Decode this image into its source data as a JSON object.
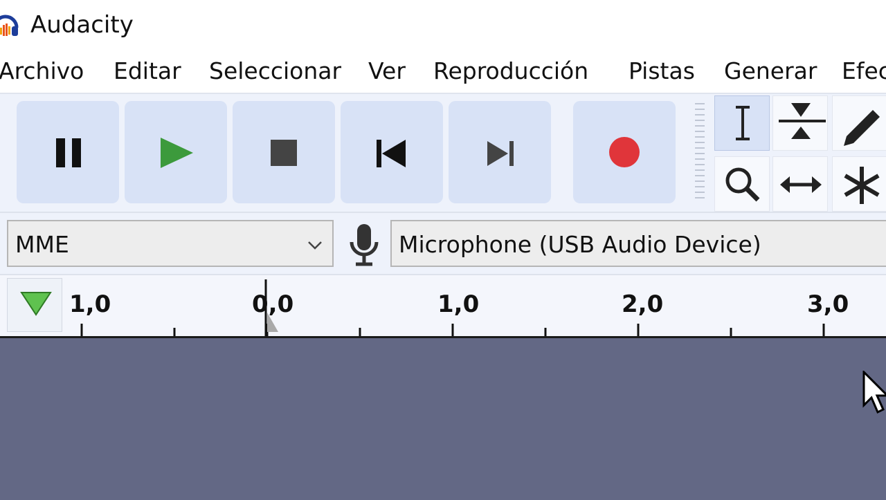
{
  "window": {
    "title": "Audacity",
    "logo_icon": "audacity-logo-icon"
  },
  "menu": {
    "items": [
      "Archivo",
      "Editar",
      "Seleccionar",
      "Ver",
      "Reproducción",
      "Pistas",
      "Generar",
      "Efec"
    ]
  },
  "transport": {
    "buttons": [
      {
        "name": "pause-button",
        "icon": "pause-icon"
      },
      {
        "name": "play-button",
        "icon": "play-icon",
        "color": "#3c9a3c"
      },
      {
        "name": "stop-button",
        "icon": "stop-icon"
      },
      {
        "name": "skip-to-start-button",
        "icon": "skip-start-icon"
      },
      {
        "name": "skip-to-end-button",
        "icon": "skip-end-icon"
      },
      {
        "name": "record-button",
        "icon": "record-icon",
        "color": "#e0353a"
      }
    ]
  },
  "tools": {
    "items": [
      {
        "name": "selection-tool",
        "icon": "i-beam-icon",
        "active": true
      },
      {
        "name": "envelope-tool",
        "icon": "envelope-icon"
      },
      {
        "name": "draw-tool",
        "icon": "pencil-icon"
      },
      {
        "name": "zoom-tool",
        "icon": "magnifier-icon"
      },
      {
        "name": "time-shift-tool",
        "icon": "double-arrow-icon"
      },
      {
        "name": "multi-tool",
        "icon": "asterisk-icon"
      }
    ]
  },
  "devices": {
    "host": "MME",
    "input_device": "Microphone (USB Audio Device)",
    "mic_icon": "microphone-icon"
  },
  "ruler": {
    "labels": [
      "1,0",
      "0,0",
      "1,0",
      "2,0",
      "3,0"
    ]
  },
  "colors": {
    "toolbar_bg": "#eef2fb",
    "button_bg": "#d8e2f6",
    "track_bg": "#636885",
    "play_green": "#3c9a3c",
    "record_red": "#e0353a"
  }
}
